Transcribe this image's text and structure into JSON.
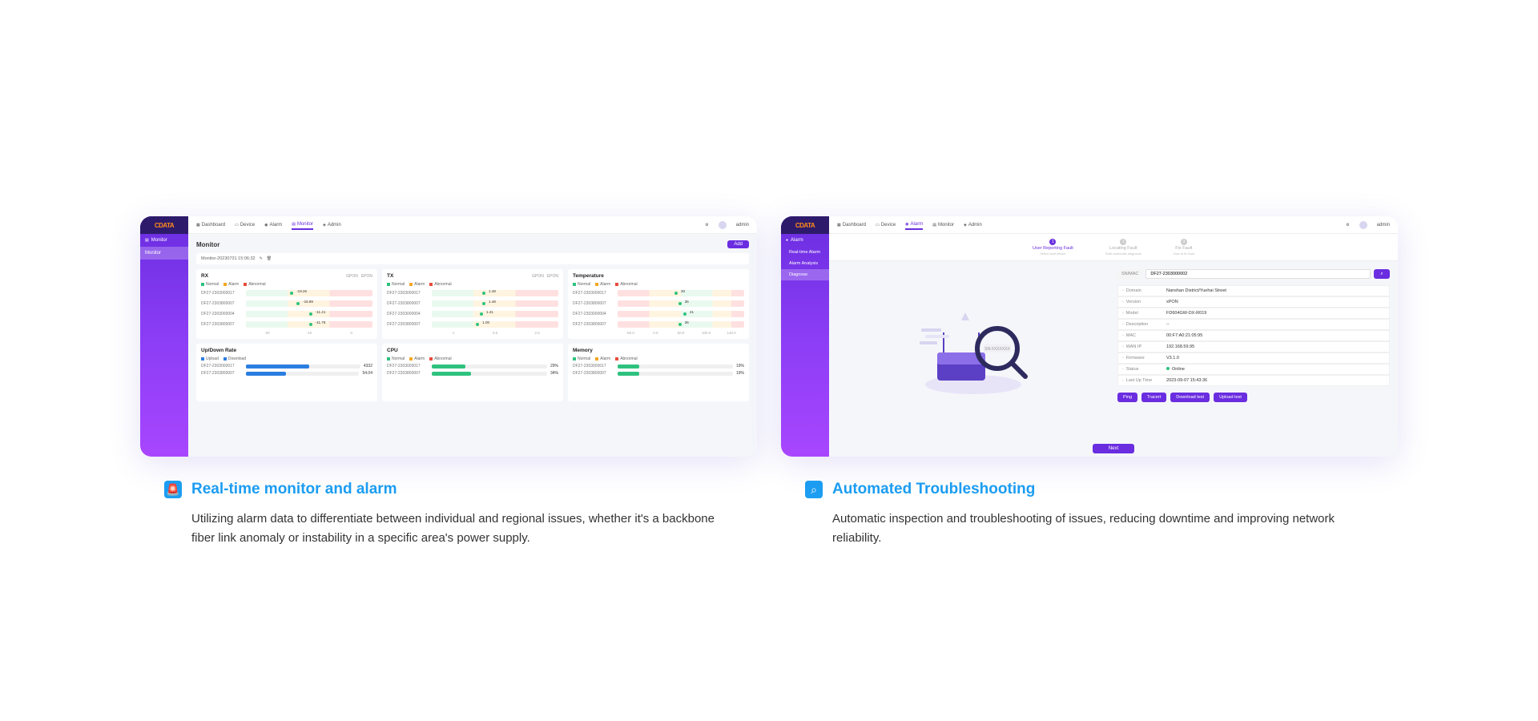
{
  "logo": "CDATA",
  "topnav": [
    "Dashboard",
    "Device",
    "Alarm",
    "Monitor",
    "Admin"
  ],
  "user": "admin",
  "left": {
    "side": {
      "root": "Monitor",
      "items": [
        "Monitor"
      ]
    },
    "active_nav": "Monitor",
    "title": "Monitor",
    "add": "Add",
    "crumb": "Monitor-20230731 15:06:32",
    "panels": {
      "rx": {
        "title": "RX",
        "tags": [
          "GPON",
          "EPON"
        ],
        "legend": [
          "Normal",
          "Alarm",
          "Abnormal"
        ],
        "rows": [
          {
            "id": "DF27-2303000017",
            "val": "-19.26",
            "pos": 35
          },
          {
            "id": "DF27-2303800007",
            "val": "-15.89",
            "pos": 40
          },
          {
            "id": "DF27-2303000004",
            "val": "-11.41",
            "pos": 50
          },
          {
            "id": "DF27-2303800007",
            "val": "-11.78",
            "pos": 50
          }
        ],
        "axis": [
          "-30",
          "-10",
          "0"
        ]
      },
      "tx": {
        "title": "TX",
        "tags": [
          "GPON",
          "EPON"
        ],
        "legend": [
          "Normal",
          "Alarm",
          "Abnormal"
        ],
        "rows": [
          {
            "id": "DF27-2303000017",
            "val": "1.48",
            "pos": 40
          },
          {
            "id": "DF27-2303800007",
            "val": "1.48",
            "pos": 40
          },
          {
            "id": "DF27-2303000004",
            "val": "1.41",
            "pos": 38
          },
          {
            "id": "DF27-2303800007",
            "val": "1.00",
            "pos": 35
          }
        ],
        "axis": [
          "-1",
          "0.5",
          "2.5"
        ]
      },
      "temp": {
        "title": "Temperature",
        "legend": [
          "Normal",
          "Alarm",
          "Abnormal"
        ],
        "rows": [
          {
            "id": "DF27-2303000017",
            "val": "30",
            "pos": 45
          },
          {
            "id": "DF27-2303800007",
            "val": "36",
            "pos": 48
          },
          {
            "id": "DF27-2303000004",
            "val": "41",
            "pos": 52
          },
          {
            "id": "DF27-2303800007",
            "val": "36",
            "pos": 48
          }
        ],
        "axis": [
          "-50.0",
          "0.0",
          "50.0",
          "100.0",
          "140.0"
        ]
      },
      "updown": {
        "title": "Up/Down Rate",
        "legend": [
          "Upload",
          "Download"
        ],
        "rows": [
          {
            "id": "DF27-2303000017",
            "val": "4332",
            "pct": 55,
            "color": "#2a7de1"
          },
          {
            "id": "DF27-2303800007",
            "val": "54.04",
            "pct": 35,
            "color": "#2a7de1"
          }
        ]
      },
      "cpu": {
        "title": "CPU",
        "legend": [
          "Normal",
          "Alarm",
          "Abnormal"
        ],
        "rows": [
          {
            "id": "DF27-2303000017",
            "val": "29%",
            "pct": 29,
            "color": "#2ec27e"
          },
          {
            "id": "DF27-2303800007",
            "val": "34%",
            "pct": 34,
            "color": "#2ec27e"
          }
        ]
      },
      "mem": {
        "title": "Memory",
        "legend": [
          "Normal",
          "Alarm",
          "Abnormal"
        ],
        "rows": [
          {
            "id": "DF27-2303000017",
            "val": "19%",
            "pct": 19,
            "color": "#2ec27e"
          },
          {
            "id": "DF27-2303800007",
            "val": "19%",
            "pct": 19,
            "color": "#2ec27e"
          }
        ]
      }
    }
  },
  "right": {
    "side": {
      "root": "Alarm",
      "items": [
        "Real-time Alarm",
        "Alarm Analysis",
        "Diagnose"
      ]
    },
    "active_nav": "Alarm",
    "side_active": "Diagnose",
    "steps": [
      {
        "n": "1",
        "label": "User Reporting Fault",
        "sub": "Select fault device"
      },
      {
        "n": "2",
        "label": "Locating Fault",
        "sub": "Start automatic diagnosis"
      },
      {
        "n": "3",
        "label": "Fix Fault",
        "sub": "How to fix fault"
      }
    ],
    "search": {
      "label": "SN/MAC",
      "value": "DF27-2303000002"
    },
    "info": [
      {
        "k": "Domain",
        "v": "Nanshan District/Yuehai Street"
      },
      {
        "k": "Version",
        "v": "xPON"
      },
      {
        "k": "Model",
        "v": "FD604GW-DX-R019"
      },
      {
        "k": "Description",
        "v": "--"
      },
      {
        "k": "MAC",
        "v": "00:F7:A0:21:05:95"
      },
      {
        "k": "WAN IP",
        "v": "192.168.59.95"
      },
      {
        "k": "Firmware",
        "v": "V3.1.0"
      },
      {
        "k": "Status",
        "v": "Online",
        "dot": true
      },
      {
        "k": "Last Up Time",
        "v": "2023-09-07 15:43:36"
      }
    ],
    "actions": [
      "Ping",
      "Tracert",
      "Download test",
      "Upload test"
    ],
    "next": "Next"
  },
  "captions": [
    {
      "title": "Real-time monitor and alarm",
      "text": "Utilizing alarm data to differentiate between individual and regional issues, whether it's a backbone fiber link anomaly or instability in a specific area's power supply."
    },
    {
      "title": "Automated Troubleshooting",
      "text": "Automatic inspection and troubleshooting of issues, reducing downtime and improving network reliability."
    }
  ]
}
